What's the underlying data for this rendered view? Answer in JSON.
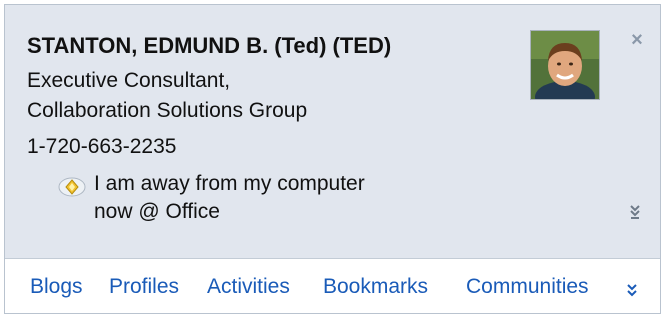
{
  "person": {
    "name": "STANTON, EDMUND B. (Ted) (TED)",
    "title_line1": "Executive Consultant,",
    "title_line2": "Collaboration Solutions Group",
    "phone": "1-720-663-2235",
    "status_line1": "I am away from my computer",
    "status_line2": "now @ Office"
  },
  "icons": {
    "close": "close-icon",
    "status": "away-status-icon",
    "expand": "expand-more-icon",
    "links_more": "chevron-double-down-icon",
    "avatar": "profile-photo"
  },
  "links": {
    "blogs": "Blogs",
    "profiles": "Profiles",
    "activities": "Activities",
    "bookmarks": "Bookmarks",
    "communities": "Communities"
  },
  "colors": {
    "header_bg": "#e1e6ee",
    "link": "#1a5bb8",
    "status_diamond": "#f2c230"
  }
}
